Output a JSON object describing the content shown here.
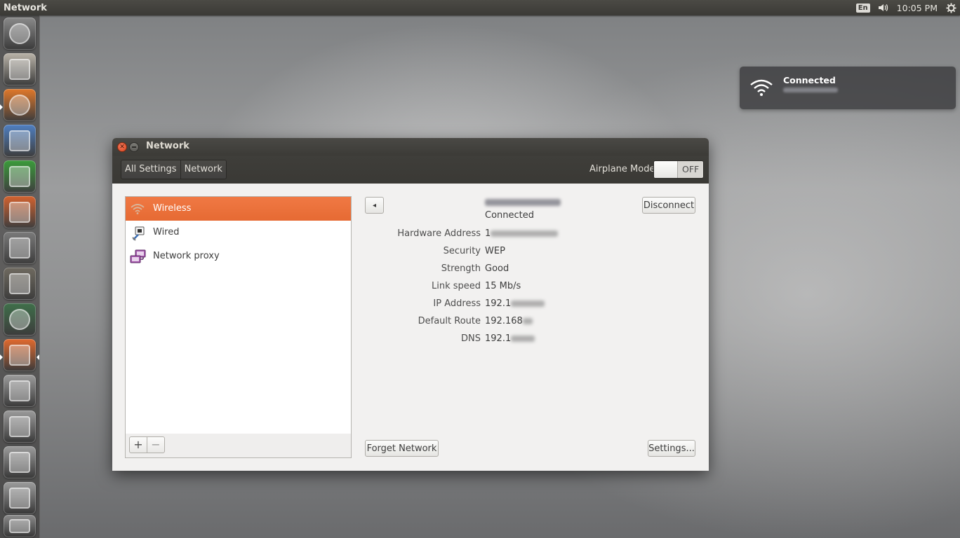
{
  "top_panel": {
    "app_title": "Network",
    "keyboard": "En",
    "clock": "10:05 PM"
  },
  "launcher": {
    "items": [
      {
        "name": "ubuntu-dash",
        "color": "#8a8a8a"
      },
      {
        "name": "files",
        "color": "#b9b3a8"
      },
      {
        "name": "firefox",
        "color": "#e0782a"
      },
      {
        "name": "libreoffice-writer",
        "color": "#4f7fc1"
      },
      {
        "name": "libreoffice-calc",
        "color": "#3b9b3b"
      },
      {
        "name": "libreoffice-impress",
        "color": "#d2622f"
      },
      {
        "name": "system-settings",
        "color": "#7a7a7a"
      },
      {
        "name": "gimp",
        "color": "#6f6a60"
      },
      {
        "name": "software-updater",
        "color": "#3f6f4a"
      },
      {
        "name": "system-installer",
        "color": "#e06a2e"
      },
      {
        "name": "drive-1",
        "color": "#9c9c9c"
      },
      {
        "name": "drive-2",
        "color": "#9c9c9c"
      },
      {
        "name": "drive-3",
        "color": "#9c9c9c"
      },
      {
        "name": "drive-4",
        "color": "#9c9c9c"
      },
      {
        "name": "trash",
        "color": "#8c8c8c"
      }
    ]
  },
  "notification": {
    "title": "Connected"
  },
  "window": {
    "title": "Network",
    "breadcrumbs": [
      "All Settings",
      "Network"
    ],
    "airplane_mode_label": "Airplane Mode",
    "airplane_mode_state": "OFF",
    "connections": [
      {
        "label": "Wireless",
        "icon": "wifi-icon",
        "selected": true
      },
      {
        "label": "Wired",
        "icon": "wired-network-icon",
        "selected": false
      },
      {
        "label": "Network proxy",
        "icon": "network-proxy-icon",
        "selected": false
      }
    ],
    "add_label": "+",
    "remove_label": "−",
    "back_label": "◂",
    "status": "Connected",
    "disconnect_label": "Disconnect",
    "details": [
      {
        "key": "Hardware Address",
        "value": "1"
      },
      {
        "key": "Security",
        "value": "WEP"
      },
      {
        "key": "Strength",
        "value": "Good"
      },
      {
        "key": "Link speed",
        "value": "15 Mb/s"
      },
      {
        "key": "IP Address",
        "value": "192.1"
      },
      {
        "key": "Default Route",
        "value": "192.168"
      },
      {
        "key": "DNS",
        "value": "192.1"
      }
    ],
    "forget_label": "Forget Network",
    "settings_label": "Settings...",
    "accent_color": "#ef7541"
  }
}
